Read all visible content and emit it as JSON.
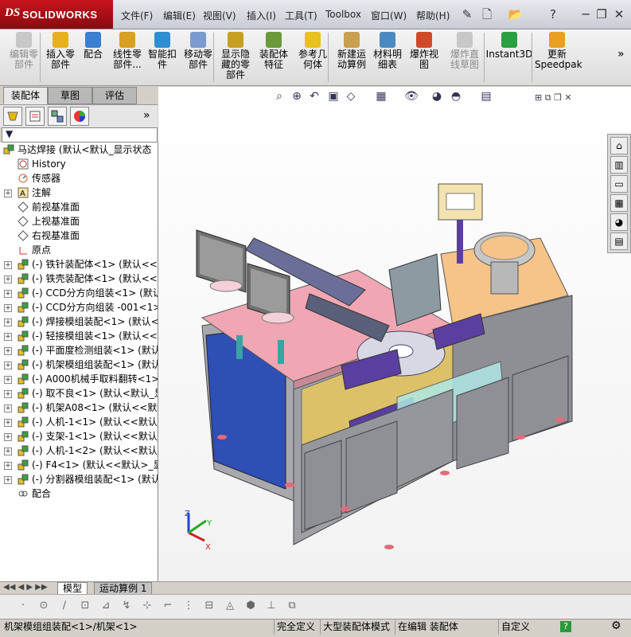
{
  "app": {
    "brand": "SOLIDWORKS",
    "brand_prefix": "DS"
  },
  "menu": [
    "文件(F)",
    "编辑(E)",
    "视图(V)",
    "插入(I)",
    "工具(T)",
    "Toolbox",
    "窗口(W)",
    "帮助(H)"
  ],
  "window_controls": {
    "minimize": "─",
    "restore": "❐",
    "close": "✕"
  },
  "commands": [
    {
      "label": "编辑零\n部件",
      "disabled": true
    },
    {
      "label": "插入零\n部件",
      "disabled": false
    },
    {
      "label": "配合",
      "disabled": false
    },
    {
      "label": "线性零\n部件...",
      "disabled": false
    },
    {
      "label": "智能扣\n件",
      "disabled": false
    },
    {
      "label": "移动零\n部件",
      "disabled": false
    },
    {
      "label": "显示隐\n藏的零\n部件",
      "disabled": false
    },
    {
      "label": "装配体\n特征",
      "disabled": false
    },
    {
      "label": "参考几\n何体",
      "disabled": false
    },
    {
      "label": "新建运\n动算例",
      "disabled": false
    },
    {
      "label": "材料明\n细表",
      "disabled": false
    },
    {
      "label": "爆炸视\n图",
      "disabled": false
    },
    {
      "label": "爆炸直\n线草图",
      "disabled": true
    },
    {
      "label": "Instant3D",
      "disabled": false
    },
    {
      "label": "更新\nSpeedpak",
      "disabled": false
    }
  ],
  "more_label": "»",
  "panel_tabs": [
    "装配体",
    "草图",
    "评估"
  ],
  "tree": {
    "root": "马达焊接  (默认<默认_显示状态",
    "fixed": [
      {
        "label": "History",
        "icon": "history-icon"
      },
      {
        "label": "传感器",
        "icon": "sensor-icon"
      },
      {
        "label": "注解",
        "icon": "annotation-icon"
      },
      {
        "label": "前视基准面",
        "icon": "plane-icon"
      },
      {
        "label": "上视基准面",
        "icon": "plane-icon"
      },
      {
        "label": "右视基准面",
        "icon": "plane-icon"
      },
      {
        "label": "原点",
        "icon": "origin-icon"
      }
    ],
    "parts": [
      "(-) 铁针装配体<1> (默认<<",
      "(-) 铁壳装配体<1> (默认<<默",
      "(-) CCD分方向组装<1> (默认",
      "(-) CCD分方向组装 -001<1>",
      "(-) 焊接模组装配<1> (默认<",
      "(-) 轻接模组装<1> (默认<<",
      "(-) 平面度检测组装<1> (默认",
      "(-) 机架模组组装配<1> (默认",
      "(-) A000机械手取料翻转<1> (",
      "(-) 取不良<1> (默认<默认_显",
      "(-) 机架A08<1> (默认<<默认",
      "(-) 人机-1<1> (默认<<默认_",
      "(-) 支架-1<1> (默认<<默认_",
      "(-) 人机-1<2> (默认<<默认_",
      "(-) F4<1> (默认<<默认>_显示",
      "(-) 分割器模组装配<1> (默认"
    ],
    "mates": "配合"
  },
  "bottom_tabs": [
    "模型",
    "运动算例 1"
  ],
  "status": {
    "path": "机架模组组装配<1>/机架<1>",
    "fully_defined": "完全定义",
    "mode": "大型装配体模式",
    "editing": "在编辑  装配体",
    "custom": "自定义"
  },
  "triad": {
    "x": "X",
    "y": "Y",
    "z": "Z"
  },
  "colors": {
    "accent_red": "#c8141e",
    "frame_grey": "#a9a9ad",
    "table_pink": "#f0a7b3",
    "table_orange": "#f6c488",
    "door_blue": "#2e4fb5",
    "door_grey": "#9fa0a6",
    "bg": "#d4d0c8"
  }
}
